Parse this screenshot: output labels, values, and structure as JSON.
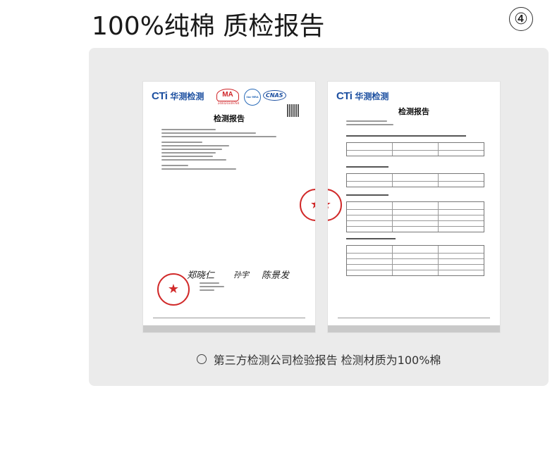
{
  "header": {
    "title": "100%纯棉 质检报告",
    "index_badge": "④"
  },
  "report_left": {
    "logo_text": "CTi",
    "logo_cn": "华测检测",
    "ma_mark": "MA",
    "ma_number": "240020349784",
    "cert_mark": "ilac-MRA",
    "cnas_mark": "CNAS",
    "doc_title": "检测报告",
    "signature_1": "郑晓仁",
    "signature_2": "孙宇",
    "signature_3": "陈景发"
  },
  "report_right": {
    "logo_text": "CTi",
    "logo_cn": "华测检测",
    "doc_title": "检测报告"
  },
  "caption": {
    "text": "第三方检测公司检验报告 检测材质为100%棉"
  },
  "colors": {
    "panel_bg": "#ebebeb",
    "brand_blue": "#1c4fa0",
    "seal_red": "#d12a2a"
  }
}
